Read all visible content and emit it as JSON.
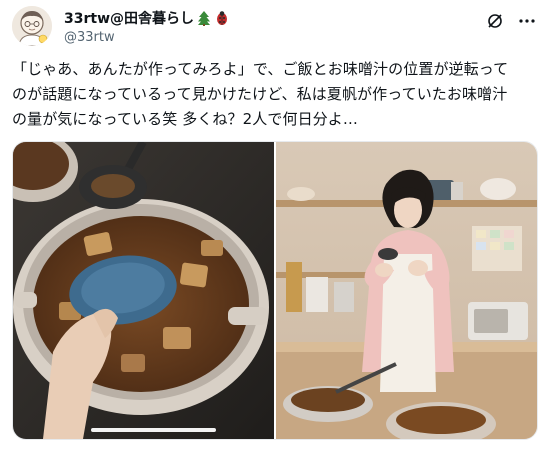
{
  "author": {
    "display_name": "33rtw@田舎暮らし",
    "handle": "@33rtw",
    "name_emojis": [
      "tree-emoji",
      "bug-emoji"
    ]
  },
  "icons": {
    "more": "more-options-icon",
    "grok": "grok-icon"
  },
  "tweet": {
    "text": "「じゃあ、あんたが作ってみろよ」で、ご飯とお味噌汁の位置が逆転って\nのが話題になっているって見かけたけど、私は夏帆が作っていたお味噌汁\nの量が気になっている笑 多くね？2人で何日分よ…"
  },
  "media": {
    "count": 2,
    "left_image": "pot-of-miso-soup-with-ladle",
    "right_image": "woman-in-apron-tasting-soup-in-kitchen"
  },
  "colors": {
    "text": "#0f1419",
    "secondary": "#536471"
  }
}
